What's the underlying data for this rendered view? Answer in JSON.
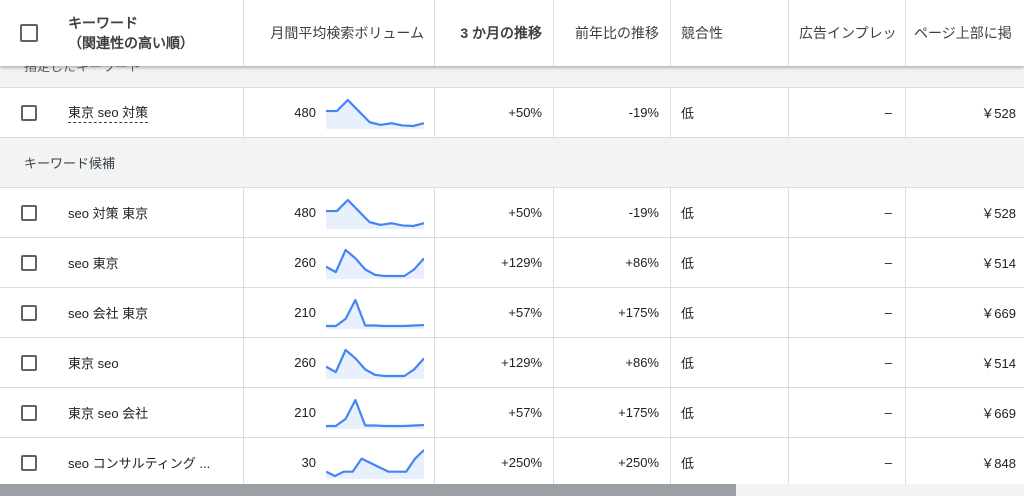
{
  "header": {
    "keyword_title": "キーワード",
    "keyword_subtitle": "（関連性の高い順）",
    "volume": "月間平均検索ボリューム",
    "three_month": "3 か月の推移",
    "yoy": "前年比の推移",
    "competition": "競合性",
    "ad_impression": "広告インプレッ",
    "top_bid": "ページ上部に掲"
  },
  "sections": {
    "top": "指定したキーワード",
    "candidates": "キーワード候補"
  },
  "colors": {
    "spark_line": "#4285f4",
    "spark_fill": "#e8f0fe"
  },
  "rows": [
    {
      "keyword": "東京 seo 対策",
      "volume": "480",
      "three_month": "+50%",
      "yoy": "-19%",
      "competition": "低",
      "impression": "–",
      "bid": "￥528",
      "trend": [
        3,
        3,
        5,
        3,
        1,
        0.5,
        0.8,
        0.4,
        0.3,
        0.8
      ]
    },
    {
      "keyword": "seo 対策 東京",
      "volume": "480",
      "three_month": "+50%",
      "yoy": "-19%",
      "competition": "低",
      "impression": "–",
      "bid": "￥528",
      "trend": [
        3,
        3,
        5,
        3,
        1,
        0.5,
        0.8,
        0.4,
        0.3,
        0.8
      ]
    },
    {
      "keyword": "seo 東京",
      "volume": "260",
      "three_month": "+129%",
      "yoy": "+86%",
      "competition": "低",
      "impression": "–",
      "bid": "￥514",
      "trend": [
        2,
        1,
        5,
        3.5,
        1.5,
        0.5,
        0.3,
        0.3,
        0.3,
        1.5,
        3.5
      ]
    },
    {
      "keyword": "seo 会社 東京",
      "volume": "210",
      "three_month": "+57%",
      "yoy": "+175%",
      "competition": "低",
      "impression": "–",
      "bid": "￥669",
      "trend": [
        0.5,
        0.5,
        2,
        6,
        0.6,
        0.6,
        0.5,
        0.5,
        0.5,
        0.6,
        0.7
      ]
    },
    {
      "keyword": "東京 seo",
      "volume": "260",
      "three_month": "+129%",
      "yoy": "+86%",
      "competition": "低",
      "impression": "–",
      "bid": "￥514",
      "trend": [
        2,
        1,
        5,
        3.5,
        1.5,
        0.5,
        0.3,
        0.3,
        0.3,
        1.5,
        3.5
      ]
    },
    {
      "keyword": "東京 seo 会社",
      "volume": "210",
      "three_month": "+57%",
      "yoy": "+175%",
      "competition": "低",
      "impression": "–",
      "bid": "￥669",
      "trend": [
        0.5,
        0.5,
        2,
        6,
        0.6,
        0.6,
        0.5,
        0.5,
        0.5,
        0.6,
        0.7
      ]
    },
    {
      "keyword": "seo コンサルティング ...",
      "volume": "30",
      "three_month": "+250%",
      "yoy": "+250%",
      "competition": "低",
      "impression": "–",
      "bid": "￥848",
      "trend": [
        1,
        0,
        1,
        1,
        4,
        3,
        2,
        1,
        1,
        1,
        4,
        6
      ]
    }
  ]
}
